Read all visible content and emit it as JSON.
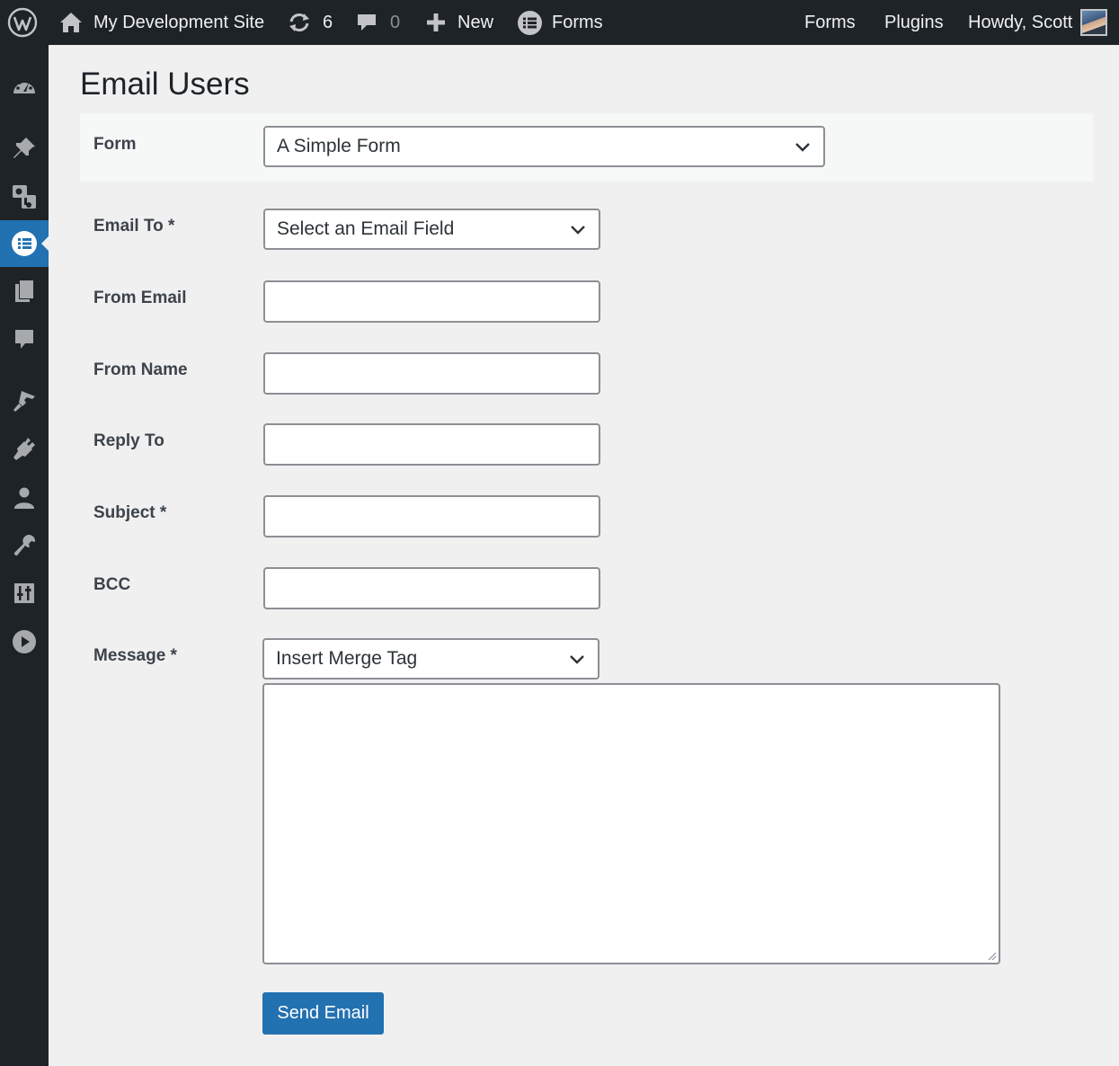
{
  "adminbar": {
    "site_name": "My Development Site",
    "updates_count": "6",
    "comments_count": "0",
    "new_label": "New",
    "forms_label": "Forms",
    "right_forms_label": "Forms",
    "right_plugins_label": "Plugins",
    "howdy": "Howdy, Scott"
  },
  "sidebar": {
    "items": [
      "dashboard",
      "posts",
      "media",
      "forms",
      "pages",
      "comments",
      "appearance",
      "plugins",
      "users",
      "tools",
      "settings",
      "media-player"
    ],
    "current": "forms"
  },
  "page": {
    "title": "Email Users"
  },
  "form": {
    "form_label": "Form",
    "form_value": "A Simple Form",
    "email_to_label": "Email To *",
    "email_to_value": "Select an Email Field",
    "from_email_label": "From Email",
    "from_email_value": "",
    "from_name_label": "From Name",
    "from_name_value": "",
    "reply_to_label": "Reply To",
    "reply_to_value": "",
    "subject_label": "Subject *",
    "subject_value": "",
    "bcc_label": "BCC",
    "bcc_value": "",
    "message_label": "Message *",
    "merge_tag_value": "Insert Merge Tag",
    "message_value": "",
    "send_label": "Send Email"
  },
  "colors": {
    "adminbar_bg": "#1d2327",
    "accent": "#2271b1",
    "page_bg": "#f0f0f1"
  }
}
